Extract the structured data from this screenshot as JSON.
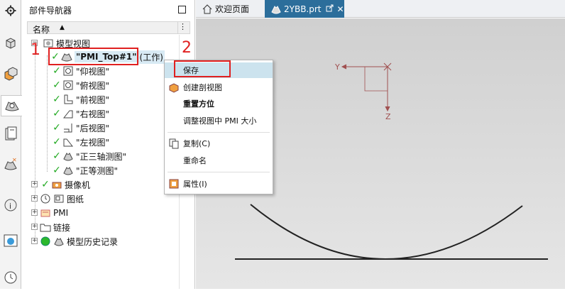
{
  "panel": {
    "title": "部件导航器",
    "column_header": "名称",
    "sort_indicator": "▲",
    "more": "⋮"
  },
  "tree": {
    "root": "模型视图",
    "pmi_top": "\"PMI_Top#1\"",
    "work_suffix": "(工作)",
    "views": [
      "\"仰视图\"",
      "\"俯视图\"",
      "\"前视图\"",
      "\"右视图\"",
      "\"后视图\"",
      "\"左视图\"",
      "\"正三轴测图\"",
      "\"正等测图\""
    ],
    "camera": "摄像机",
    "drawing": "图纸",
    "pmi": "PMI",
    "links": "链接",
    "history": "模型历史记录"
  },
  "tabs": {
    "welcome": "欢迎页面",
    "active_file": "2YBB.prt"
  },
  "context_menu": {
    "save": "保存",
    "create_section_view": "创建剖视图",
    "reset_orientation": "重置方位",
    "adjust_pmi_size": "调整视图中 PMI 大小",
    "copy": "复制(C)",
    "rename": "重命名",
    "properties": "属性(I)"
  },
  "annotations": {
    "step1": "1",
    "step2": "2"
  },
  "triad": {
    "y_label": "Y",
    "z_label": "Z"
  },
  "colors": {
    "accent_tab": "#2c6e9b",
    "check_green": "#22aa22",
    "annotation_red": "#e02020",
    "menu_highlight": "#cce3ee"
  }
}
